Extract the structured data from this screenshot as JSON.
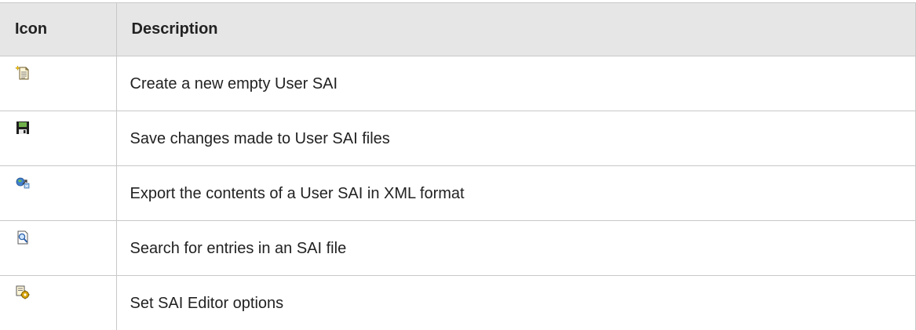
{
  "table": {
    "headers": {
      "icon": "Icon",
      "description": "Description"
    },
    "rows": [
      {
        "icon": "new-document-icon",
        "description": "Create a new empty User SAI"
      },
      {
        "icon": "save-disk-icon",
        "description": "Save changes made to User SAI files"
      },
      {
        "icon": "export-xml-icon",
        "description": "Export the contents of a User SAI in XML format"
      },
      {
        "icon": "search-file-icon",
        "description": "Search for entries in an SAI file"
      },
      {
        "icon": "editor-options-icon",
        "description": "Set SAI Editor options"
      }
    ]
  },
  "colors": {
    "header_background": "#e6e6e6",
    "border": "#c8c8c8",
    "text": "#222222"
  }
}
